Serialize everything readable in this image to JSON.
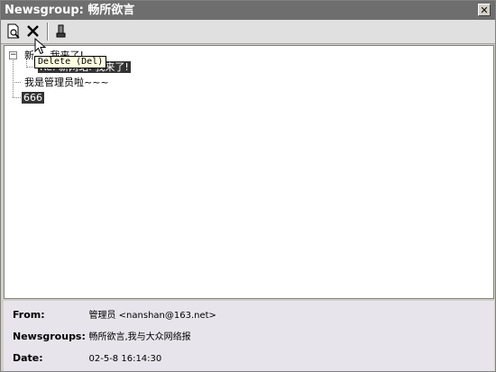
{
  "window": {
    "title": "Newsgroup: 畅所欲言",
    "close_label": "✕"
  },
  "toolbar": {
    "buttons": [
      {
        "name": "preview-icon"
      },
      {
        "name": "delete-icon"
      },
      {
        "name": "mark-icon"
      }
    ],
    "tooltip": "Delete (Del)"
  },
  "tree": {
    "nodes": [
      {
        "label": "新 ... 我来了!",
        "level": 0
      },
      {
        "label": "Re: 新网站: 我来了!",
        "level": 1
      },
      {
        "label": "我是管理员啦~~~",
        "level": 0
      },
      {
        "label": "666",
        "level": 0
      }
    ]
  },
  "details": {
    "from_label": "From:",
    "from_value": "管理员 <nanshan@163.net>",
    "newsgroups_label": "Newsgroups:",
    "newsgroups_value": "畅所欲言,我与大众网络报",
    "date_label": "Date:",
    "date_value": "02-5-8 16:14:30"
  },
  "colors": {
    "titlebar": "#6e6e6e",
    "selection": "#333333",
    "details_bg": "#e8e4ec"
  }
}
